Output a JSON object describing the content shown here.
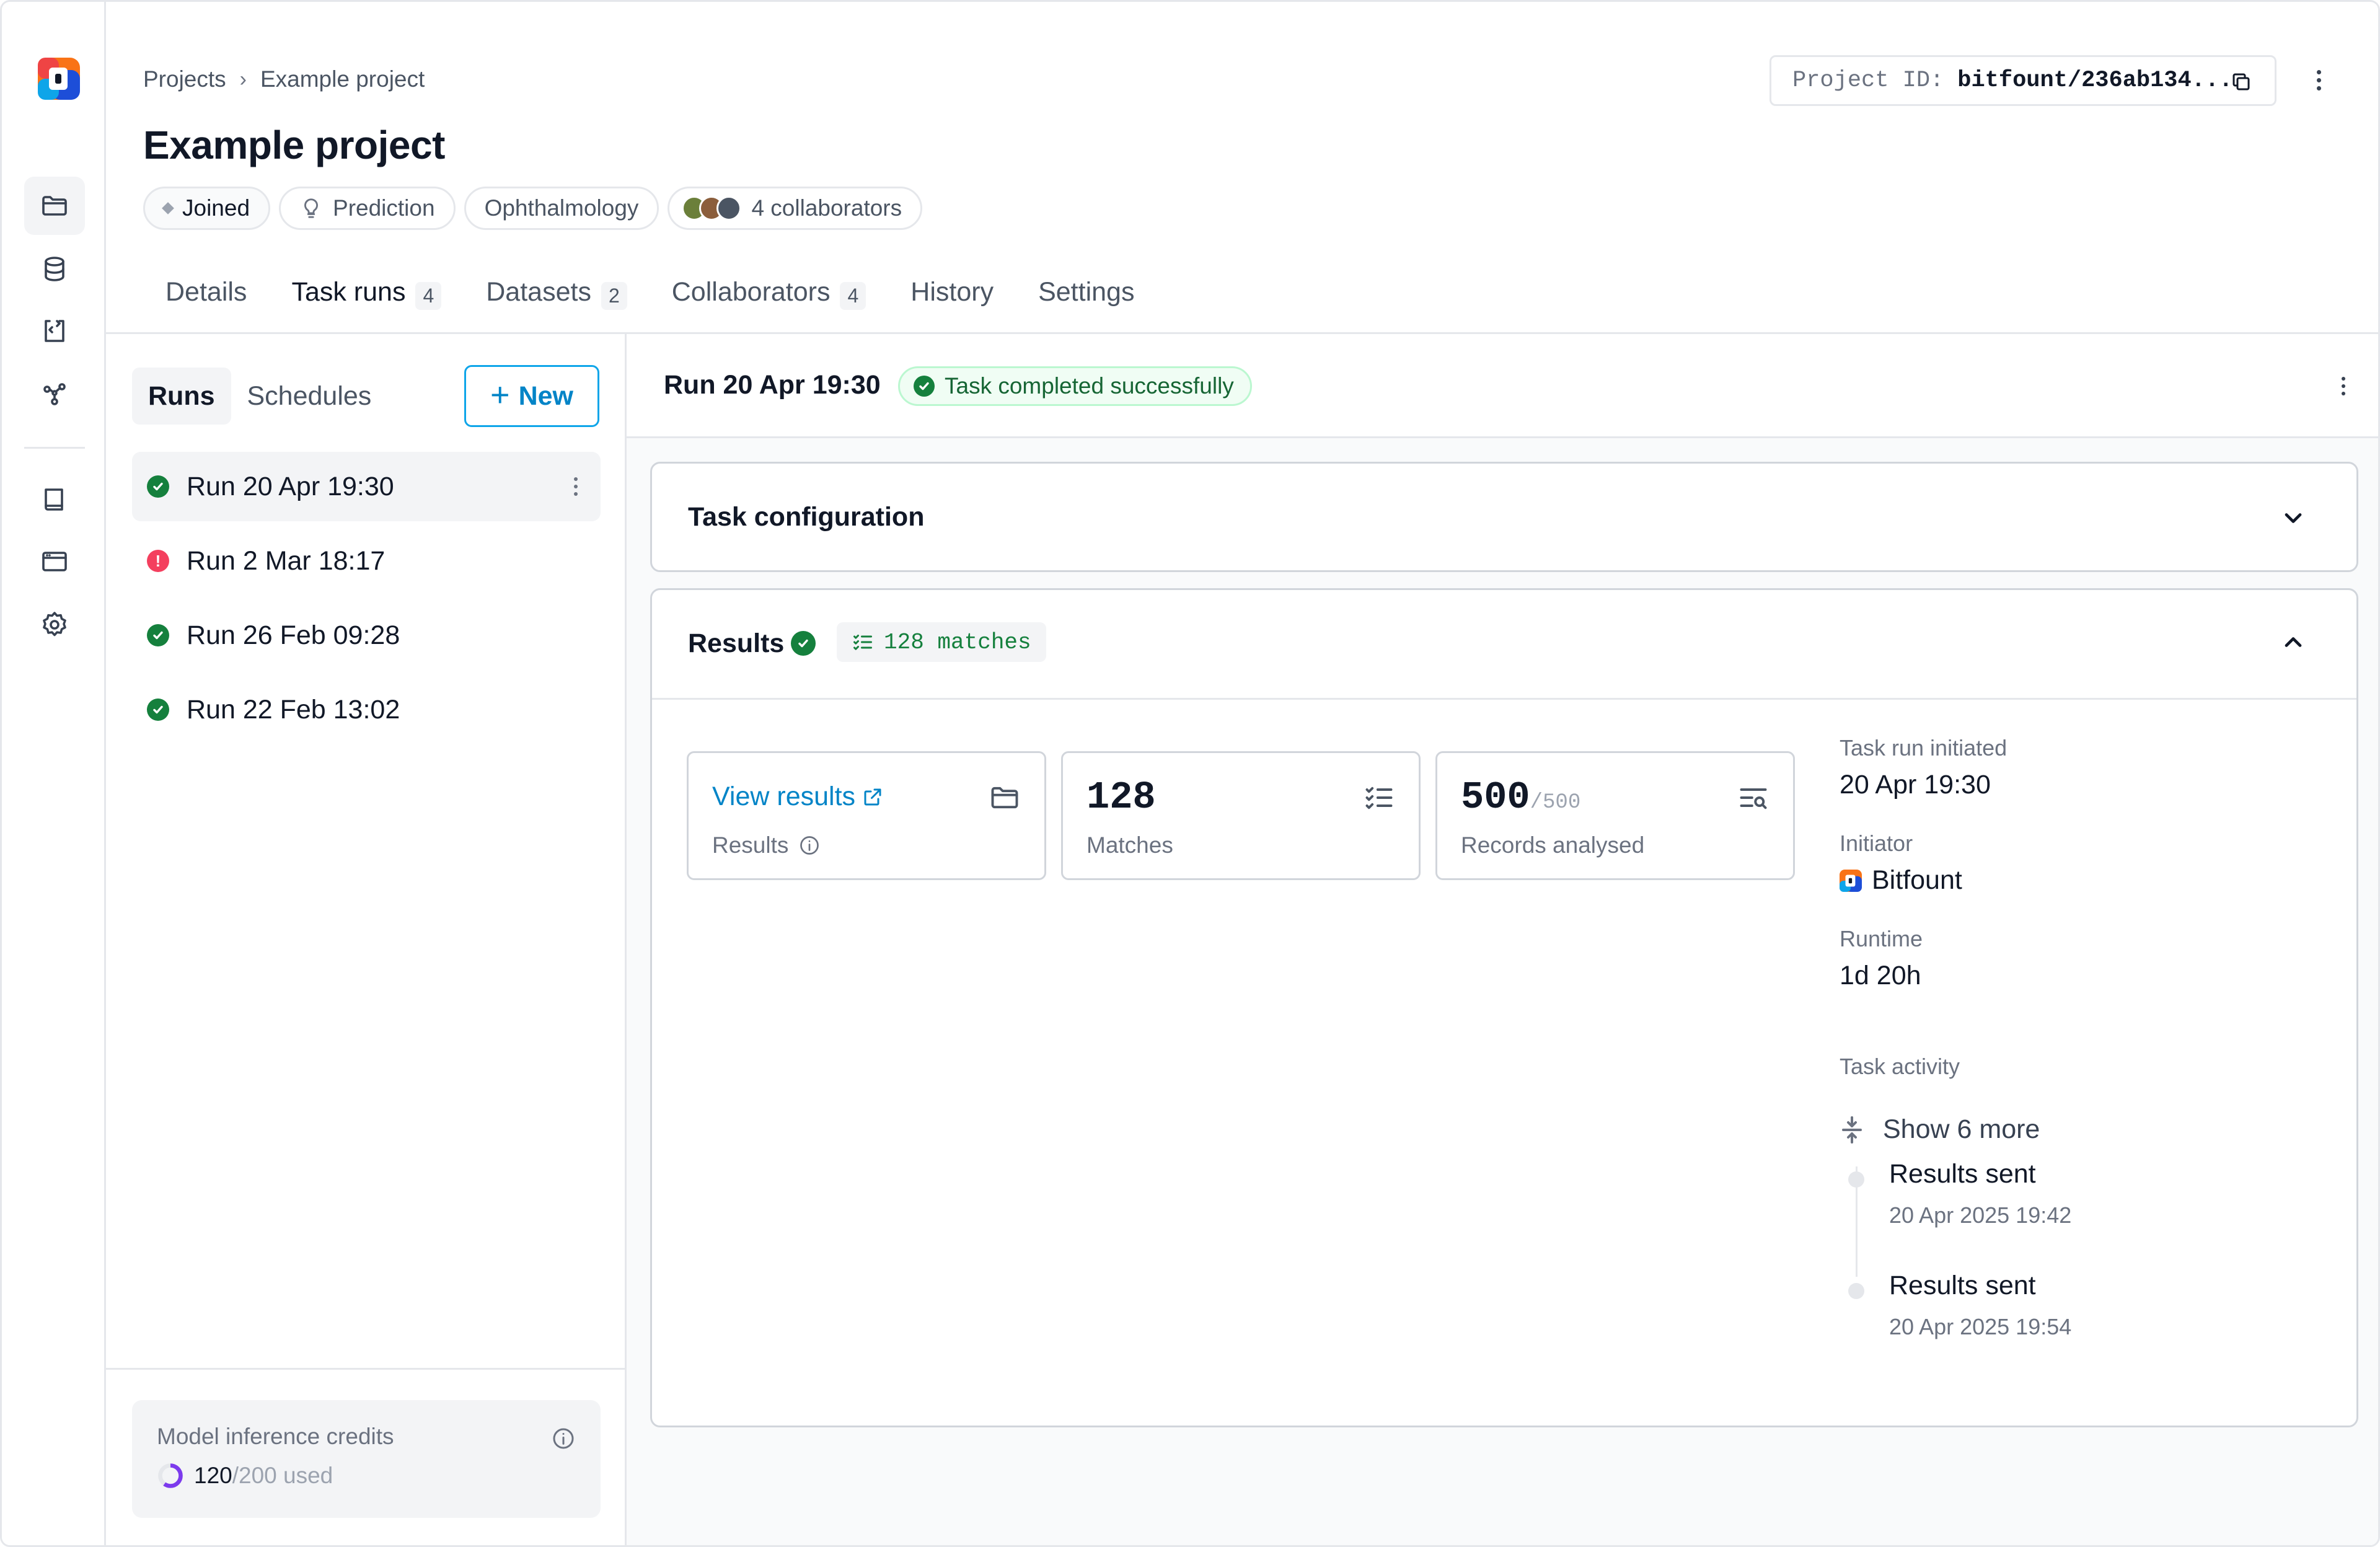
{
  "breadcrumb": {
    "root": "Projects",
    "current": "Example project"
  },
  "project": {
    "title": "Example project",
    "id_label": "Project ID:",
    "id_value": "bitfount/236ab134...",
    "chips": {
      "joined": "Joined",
      "type": "Prediction",
      "domain": "Ophthalmology",
      "collaborators": "4 collaborators"
    }
  },
  "tabs": [
    {
      "label": "Details",
      "count": ""
    },
    {
      "label": "Task runs",
      "count": "4"
    },
    {
      "label": "Datasets",
      "count": "2"
    },
    {
      "label": "Collaborators",
      "count": "4"
    },
    {
      "label": "History",
      "count": ""
    },
    {
      "label": "Settings",
      "count": ""
    }
  ],
  "runs_panel": {
    "seg_runs": "Runs",
    "seg_schedules": "Schedules",
    "new_label": "New",
    "runs": [
      {
        "label": "Run 20 Apr 19:30",
        "status": "success"
      },
      {
        "label": "Run 2 Mar 18:17",
        "status": "error"
      },
      {
        "label": "Run 26 Feb 09:28",
        "status": "success"
      },
      {
        "label": "Run 22 Feb 13:02",
        "status": "success"
      }
    ],
    "credits": {
      "label": "Model inference credits",
      "used": "120",
      "total": "/200 used",
      "fraction": 0.6
    }
  },
  "run": {
    "title": "Run 20 Apr 19:30",
    "status": "Task completed successfully",
    "config_title": "Task configuration",
    "results_title": "Results",
    "matches_chip": "128 matches",
    "cards": {
      "view_results": "View results",
      "results_sub": "Results",
      "matches_value": "128",
      "matches_sub": "Matches",
      "records_value": "500",
      "records_total": "/500",
      "records_sub": "Records analysed"
    },
    "meta": {
      "initiated_label": "Task run initiated",
      "initiated_value": "20 Apr 19:30",
      "initiator_label": "Initiator",
      "initiator_value": "Bitfount",
      "runtime_label": "Runtime",
      "runtime_value": "1d 20h"
    },
    "activity": {
      "label": "Task activity",
      "show_more": "Show 6 more",
      "items": [
        {
          "title": "Results sent",
          "date": "20 Apr 2025 19:42"
        },
        {
          "title": "Results sent",
          "date": "20 Apr 2025 19:54"
        }
      ]
    }
  },
  "colors": {
    "accent": "#0284c7",
    "tab_indicator": "#f0653a",
    "success": "#15803d",
    "error": "#f43f5e"
  }
}
